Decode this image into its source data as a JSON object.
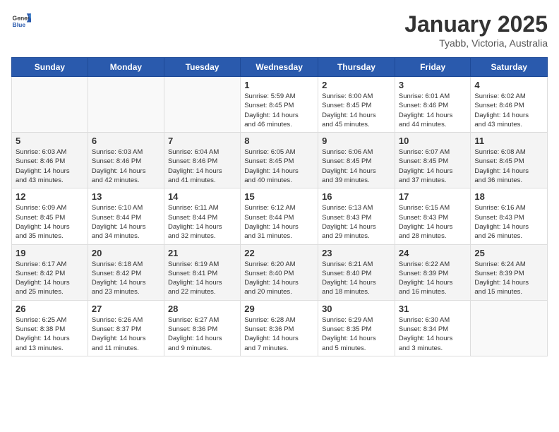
{
  "header": {
    "logo": {
      "text_general": "General",
      "text_blue": "Blue"
    },
    "title": "January 2025",
    "location": "Tyabb, Victoria, Australia"
  },
  "days_of_week": [
    "Sunday",
    "Monday",
    "Tuesday",
    "Wednesday",
    "Thursday",
    "Friday",
    "Saturday"
  ],
  "weeks": [
    [
      {
        "day": "",
        "info": ""
      },
      {
        "day": "",
        "info": ""
      },
      {
        "day": "",
        "info": ""
      },
      {
        "day": "1",
        "info": "Sunrise: 5:59 AM\nSunset: 8:45 PM\nDaylight: 14 hours\nand 46 minutes."
      },
      {
        "day": "2",
        "info": "Sunrise: 6:00 AM\nSunset: 8:45 PM\nDaylight: 14 hours\nand 45 minutes."
      },
      {
        "day": "3",
        "info": "Sunrise: 6:01 AM\nSunset: 8:46 PM\nDaylight: 14 hours\nand 44 minutes."
      },
      {
        "day": "4",
        "info": "Sunrise: 6:02 AM\nSunset: 8:46 PM\nDaylight: 14 hours\nand 43 minutes."
      }
    ],
    [
      {
        "day": "5",
        "info": "Sunrise: 6:03 AM\nSunset: 8:46 PM\nDaylight: 14 hours\nand 43 minutes."
      },
      {
        "day": "6",
        "info": "Sunrise: 6:03 AM\nSunset: 8:46 PM\nDaylight: 14 hours\nand 42 minutes."
      },
      {
        "day": "7",
        "info": "Sunrise: 6:04 AM\nSunset: 8:46 PM\nDaylight: 14 hours\nand 41 minutes."
      },
      {
        "day": "8",
        "info": "Sunrise: 6:05 AM\nSunset: 8:45 PM\nDaylight: 14 hours\nand 40 minutes."
      },
      {
        "day": "9",
        "info": "Sunrise: 6:06 AM\nSunset: 8:45 PM\nDaylight: 14 hours\nand 39 minutes."
      },
      {
        "day": "10",
        "info": "Sunrise: 6:07 AM\nSunset: 8:45 PM\nDaylight: 14 hours\nand 37 minutes."
      },
      {
        "day": "11",
        "info": "Sunrise: 6:08 AM\nSunset: 8:45 PM\nDaylight: 14 hours\nand 36 minutes."
      }
    ],
    [
      {
        "day": "12",
        "info": "Sunrise: 6:09 AM\nSunset: 8:45 PM\nDaylight: 14 hours\nand 35 minutes."
      },
      {
        "day": "13",
        "info": "Sunrise: 6:10 AM\nSunset: 8:44 PM\nDaylight: 14 hours\nand 34 minutes."
      },
      {
        "day": "14",
        "info": "Sunrise: 6:11 AM\nSunset: 8:44 PM\nDaylight: 14 hours\nand 32 minutes."
      },
      {
        "day": "15",
        "info": "Sunrise: 6:12 AM\nSunset: 8:44 PM\nDaylight: 14 hours\nand 31 minutes."
      },
      {
        "day": "16",
        "info": "Sunrise: 6:13 AM\nSunset: 8:43 PM\nDaylight: 14 hours\nand 29 minutes."
      },
      {
        "day": "17",
        "info": "Sunrise: 6:15 AM\nSunset: 8:43 PM\nDaylight: 14 hours\nand 28 minutes."
      },
      {
        "day": "18",
        "info": "Sunrise: 6:16 AM\nSunset: 8:43 PM\nDaylight: 14 hours\nand 26 minutes."
      }
    ],
    [
      {
        "day": "19",
        "info": "Sunrise: 6:17 AM\nSunset: 8:42 PM\nDaylight: 14 hours\nand 25 minutes."
      },
      {
        "day": "20",
        "info": "Sunrise: 6:18 AM\nSunset: 8:42 PM\nDaylight: 14 hours\nand 23 minutes."
      },
      {
        "day": "21",
        "info": "Sunrise: 6:19 AM\nSunset: 8:41 PM\nDaylight: 14 hours\nand 22 minutes."
      },
      {
        "day": "22",
        "info": "Sunrise: 6:20 AM\nSunset: 8:40 PM\nDaylight: 14 hours\nand 20 minutes."
      },
      {
        "day": "23",
        "info": "Sunrise: 6:21 AM\nSunset: 8:40 PM\nDaylight: 14 hours\nand 18 minutes."
      },
      {
        "day": "24",
        "info": "Sunrise: 6:22 AM\nSunset: 8:39 PM\nDaylight: 14 hours\nand 16 minutes."
      },
      {
        "day": "25",
        "info": "Sunrise: 6:24 AM\nSunset: 8:39 PM\nDaylight: 14 hours\nand 15 minutes."
      }
    ],
    [
      {
        "day": "26",
        "info": "Sunrise: 6:25 AM\nSunset: 8:38 PM\nDaylight: 14 hours\nand 13 minutes."
      },
      {
        "day": "27",
        "info": "Sunrise: 6:26 AM\nSunset: 8:37 PM\nDaylight: 14 hours\nand 11 minutes."
      },
      {
        "day": "28",
        "info": "Sunrise: 6:27 AM\nSunset: 8:36 PM\nDaylight: 14 hours\nand 9 minutes."
      },
      {
        "day": "29",
        "info": "Sunrise: 6:28 AM\nSunset: 8:36 PM\nDaylight: 14 hours\nand 7 minutes."
      },
      {
        "day": "30",
        "info": "Sunrise: 6:29 AM\nSunset: 8:35 PM\nDaylight: 14 hours\nand 5 minutes."
      },
      {
        "day": "31",
        "info": "Sunrise: 6:30 AM\nSunset: 8:34 PM\nDaylight: 14 hours\nand 3 minutes."
      },
      {
        "day": "",
        "info": ""
      }
    ]
  ]
}
